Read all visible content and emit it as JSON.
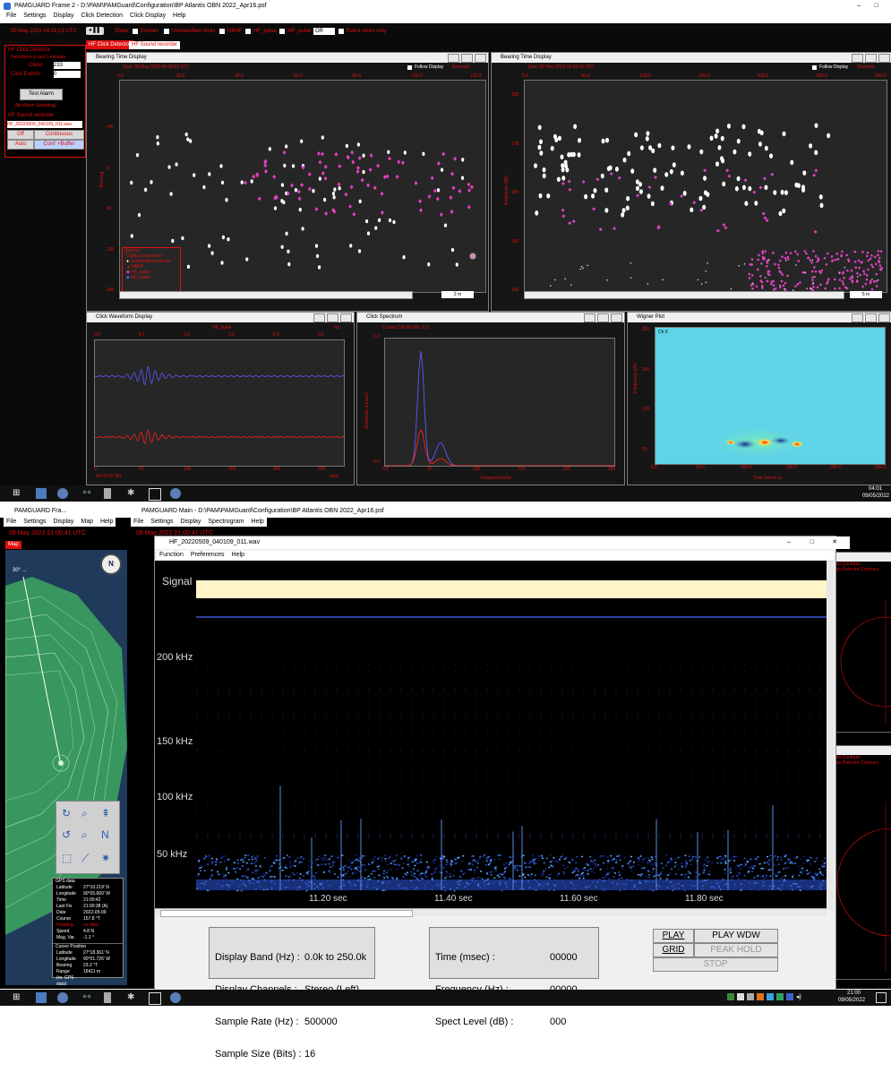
{
  "top": {
    "window_title": "PAMGUARD Frame 2 - D:\\PAM\\PAMGuard\\Configuration\\BP Atlantis OBN 2022_Apr16.psf",
    "menu": [
      "File",
      "Settings",
      "Display",
      "Click Detection",
      "Click Display",
      "Help"
    ],
    "toolbar": {
      "datetime": "09 May 2022 04:01:13 UTC",
      "show_label": "Show:",
      "filters": [
        "Echoes",
        "Unclassified clicks",
        "NBHF",
        "HF_pulse",
        "MF_pulse"
      ],
      "logic_value": "OR",
      "event_clicks": "Event clicks only"
    },
    "tabs": [
      "HF Click Detector",
      "HF Sound recorder"
    ],
    "side": {
      "detector_title": "HF Click Detector",
      "detections_label": "Detections in last 1 minutes",
      "clicks_label": "Clicks",
      "clicks_value": "233",
      "events_label": "Click Events",
      "events_value": "0",
      "test_alarm": "Test Alarm",
      "alarm_status": "(No Alarm Sounding)",
      "recorder_title": "HF Sound recorder",
      "recorder_file": "HF_20220509_040109_011.wav",
      "btn_off": "Off",
      "btn_continuous": "Continuous",
      "btn_auto": "Auto",
      "btn_buffer": "Cont' +Buffer"
    },
    "btd1": {
      "title": "Bearing Time Display",
      "follow": "Follow Display",
      "seconds": "Seconds",
      "start": "Start: 09 May 2022 04:00:02 UTC",
      "xticks": [
        "0.0",
        "20.0",
        "40.0",
        "60.0",
        "80.0",
        "100.0",
        "120.0"
      ],
      "yticks": [
        "-45",
        "0",
        "45",
        "135",
        "180"
      ],
      "ylabel": "Bearing",
      "span": "2 m",
      "legend_title": "Species",
      "legend_sub": "Colour by species",
      "legend": [
        "Unidentified species",
        "NBHF",
        "HF_pulse",
        "MF_pulse"
      ]
    },
    "btd2": {
      "title": "Bearing Time Display",
      "follow": "Follow Display",
      "seconds": "Seconds",
      "start": "Start: 09 May 2022 03:56:42 UTC",
      "xticks": [
        "0.0",
        "50.0",
        "100.0",
        "150.0",
        "200.0",
        "250.0",
        "300.0"
      ],
      "yticks": [
        "180",
        "170",
        "160",
        "150",
        "140"
      ],
      "ylabel": "Amplitude (dB)",
      "span": "5 m"
    },
    "waveform": {
      "title": "Click Waveform Display",
      "species": "HF_pulse",
      "xticks": [
        "0.0",
        "0.1",
        "0.2",
        "0.3",
        "0.4",
        "0.5"
      ],
      "xlabel": "ms",
      "bticks": [
        "0",
        "50",
        "100",
        "150",
        "200",
        "250"
      ],
      "bunit": "bins",
      "time": "04:01:02.351"
    },
    "spectrum": {
      "title": "Click Spectrum",
      "cursor": "Cursor 126.95 kHz, 0.2",
      "ylabel": "Amplitude (Linear)",
      "xlabel": "Frequency kHz",
      "xticks": [
        "0.0",
        "50",
        "100",
        "150",
        "200",
        "250"
      ],
      "yticks": [
        "1.0",
        "0.0"
      ]
    },
    "wigner": {
      "title": "Wigner Plot",
      "ch": "Ch 0",
      "ylabel": "Frequency kHz",
      "xlabel": "Time (micro-s)",
      "xticks": [
        "0.0",
        "50.0",
        "100.0",
        "150.0",
        "200.0",
        "250.0"
      ],
      "yticks": [
        "250",
        "150",
        "100",
        "50"
      ]
    },
    "clock": "04:01",
    "date": "09/05/2022"
  },
  "bottom": {
    "map_window_title": "PAMGUARD Fra...",
    "map_menu": [
      "File",
      "Settings",
      "Display",
      "Map",
      "Help"
    ],
    "map_datetime": "09 May 2022 21:00:41 UTC",
    "map_tab": "Map",
    "compass": "N",
    "gps": {
      "title": "GPS data",
      "rows": [
        [
          "Latitude",
          "27°10.219' N"
        ],
        [
          "Longitude",
          "90°05.660' W"
        ],
        [
          "Time",
          "21:00:42"
        ],
        [
          "Last Fix",
          "21:00:38 (A)"
        ],
        [
          "Date",
          "2022-05-09"
        ],
        [
          "Course",
          "157.8 °T"
        ],
        [
          "Heading",
          "no data"
        ],
        [
          "Speed",
          "4.8 N"
        ],
        [
          "Mag. Var.",
          "-1.1 °"
        ]
      ]
    },
    "cursor": {
      "title": "Cursor Position",
      "rows": [
        [
          "Latitude",
          "27°18.361' N"
        ],
        [
          "Longitude",
          "90°01.726' W"
        ],
        [
          "Bearing",
          "23.2 °T"
        ],
        [
          "Range",
          "16411 m"
        ],
        [
          "(re. GPS data)",
          ""
        ]
      ]
    },
    "main_title": "PAMGUARD Main - D:\\PAM\\PAMGuard\\Configuration\\BP Atlantis OBN 2022_Apr16.psf",
    "main_menu": [
      "File",
      "Settings",
      "Display",
      "Spectrogram",
      "Help"
    ],
    "main_datetime": "09 May 2022 21:00:41 UTC",
    "right_legend": [
      "ctor Contours",
      "ean Detector Contours"
    ],
    "spec_window": {
      "title": "HF_20220509_040109_011.wav",
      "menu": [
        "Function",
        "Preferences",
        "Help"
      ],
      "signal_label": "Signal",
      "freq_labels": [
        "200 kHz",
        "150 kHz",
        "100 kHz",
        "50 kHz"
      ],
      "time_labels": [
        "11.20 sec",
        "11.40 sec",
        "11.60 sec",
        "11.80 sec"
      ],
      "info_left": {
        "display_band_label": "Display Band (Hz) :",
        "display_band": "0.0k to 250.0k",
        "channels_label": "Display Channels :",
        "channels": "Stereo (Left)",
        "rate_label": "Sample Rate (Hz) :",
        "rate": "500000",
        "size_label": "Sample Size (Bits) :",
        "size": "16"
      },
      "info_mid": {
        "time_label": "Time (msec) :",
        "time": "00000",
        "freq_label": "Frequency (Hz) :",
        "freq": "00000",
        "level_label": "Spect Level (dB) :",
        "level": "000"
      },
      "buttons": {
        "play": "PLAY",
        "play_wdw": "PLAY WDW",
        "grid": "GRID",
        "peak_hold": "PEAK HOLD",
        "stop": "STOP"
      }
    },
    "clock": "21:00",
    "date": "09/05/2022"
  },
  "colors": {
    "accent_red": "#e01010",
    "magenta": "#e040c0",
    "spectrogram_bg": "#000000",
    "signal_band": "#fff5c8",
    "wigner_bg": "#5fd3e8"
  }
}
